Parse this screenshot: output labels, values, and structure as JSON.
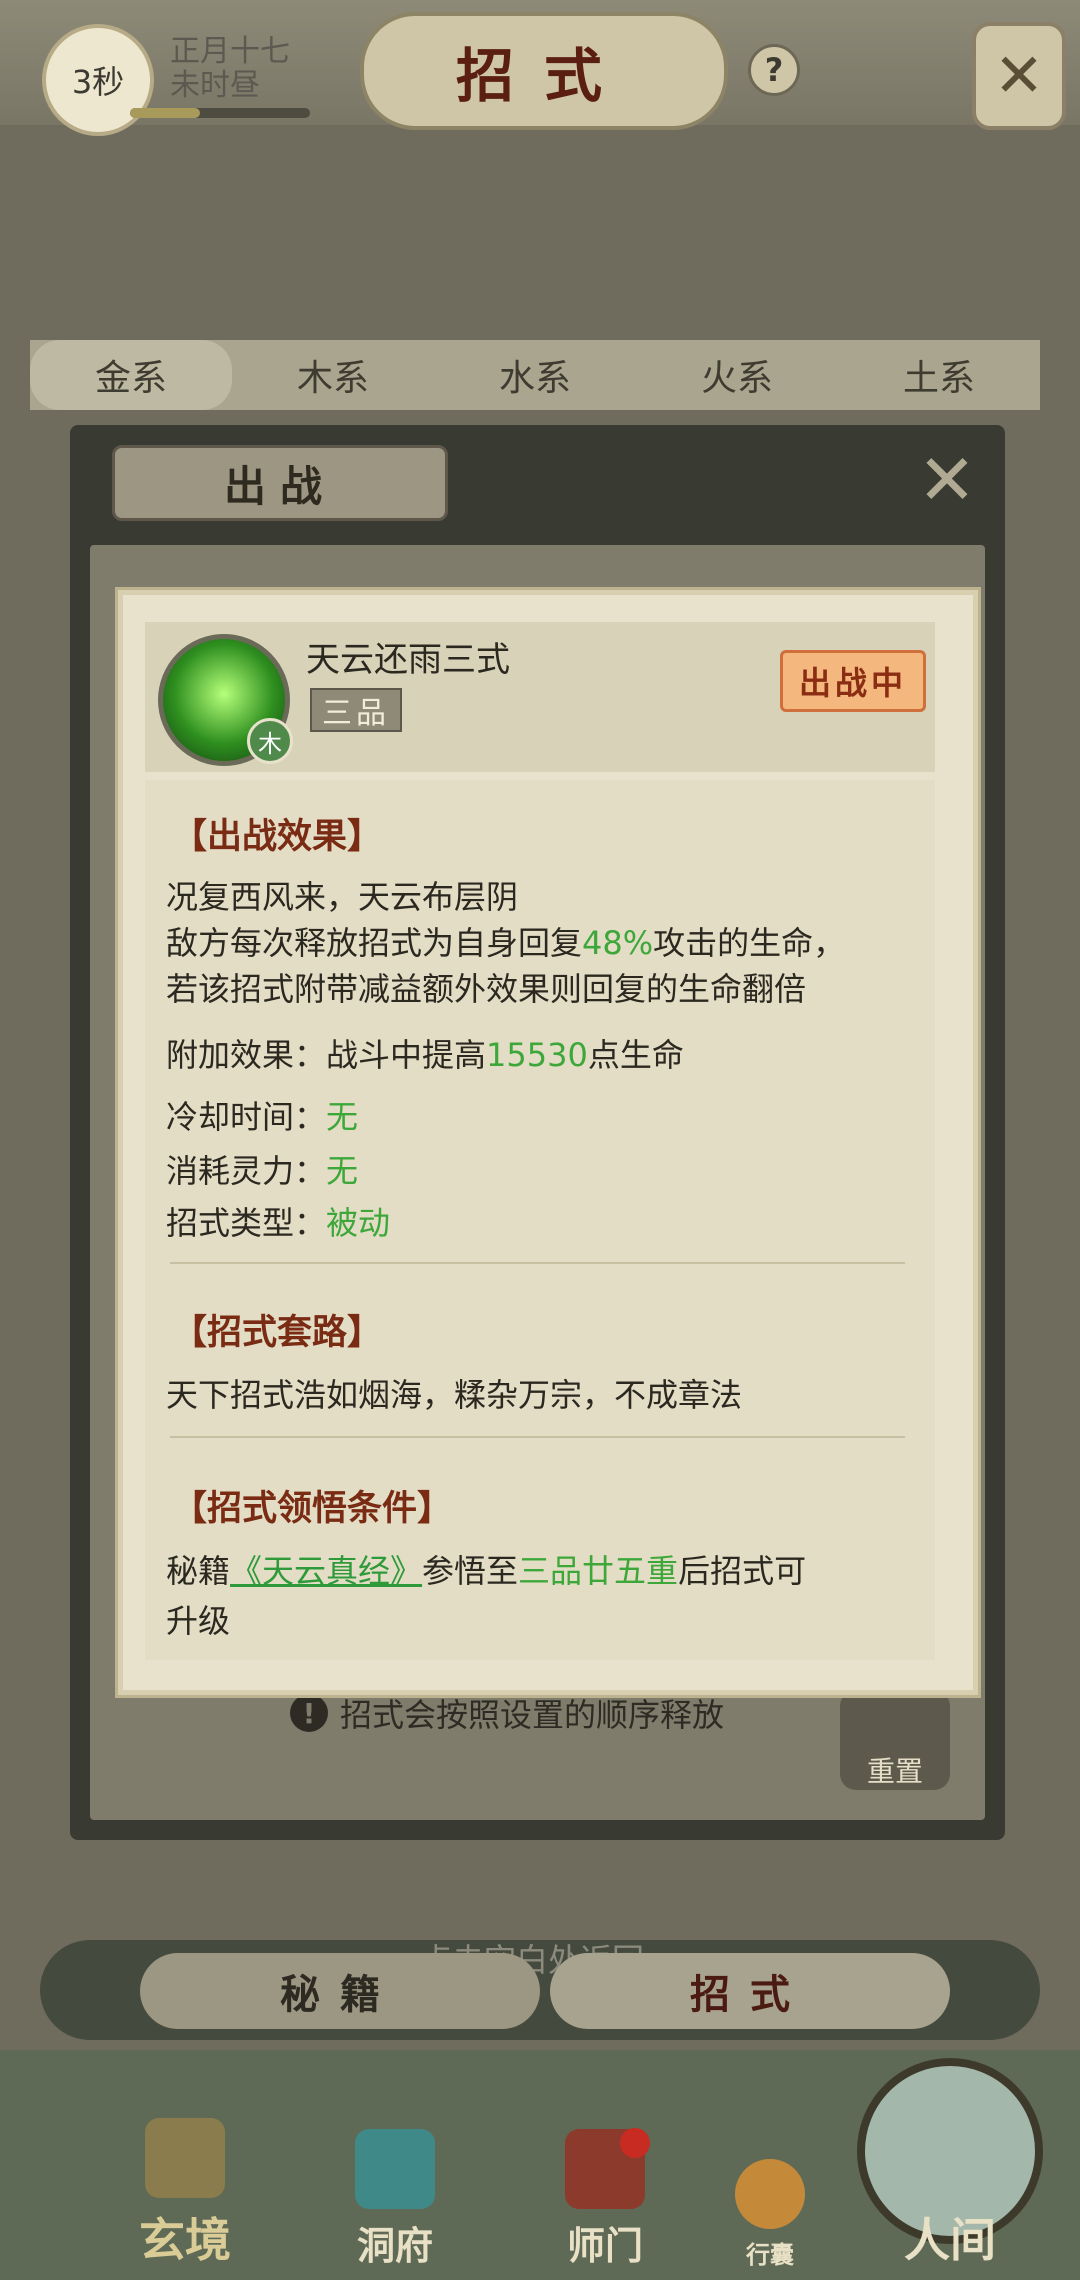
{
  "topbar": {
    "timer": "3秒",
    "date_line1": "正月十七",
    "date_line2": "未时昼",
    "title": "招式",
    "help": "?"
  },
  "element_tabs": [
    "金系",
    "木系",
    "水系",
    "火系",
    "土系"
  ],
  "panel": {
    "header": "出战",
    "hint": "招式会按照设置的顺序释放",
    "reset": "重置"
  },
  "skill": {
    "name": "天云还雨三式",
    "grade": "三品",
    "element_badge": "木",
    "status": "出战中",
    "effect_title": "【出战效果】",
    "effect_line1": "况复西风来，天云布层阴",
    "effect_line2_a": "敌方每次释放招式为自身回复",
    "effect_line2_value": "48%",
    "effect_line2_b": "攻击的生命，",
    "effect_line3": "若该招式附带减益额外效果则回复的生命翻倍",
    "extra_label": "附加效果：战斗中提高",
    "extra_value": "15530",
    "extra_suffix": "点生命",
    "cooldown_label": "冷却时间：",
    "cooldown_value": "无",
    "cost_label": "消耗灵力：",
    "cost_value": "无",
    "type_label": "招式类型：",
    "type_value": "被动",
    "routine_title": "【招式套路】",
    "routine_text": "天下招式浩如烟海，糅杂万宗，不成章法",
    "cond_title": "【招式领悟条件】",
    "cond_prefix": "秘籍",
    "cond_book": "《天云真经》",
    "cond_mid": "参悟至",
    "cond_level": "三品廿五重",
    "cond_suffix": "后招式可",
    "cond_line2": "升级"
  },
  "back_hint": "点击空白处返回",
  "bottom_tabs": {
    "left": "秘籍",
    "right": "招式"
  },
  "nav": {
    "item1": "玄境",
    "item2": "洞府",
    "item3": "师门",
    "item4": "行囊",
    "item5": "人间"
  },
  "colors": {
    "highlight_green": "#3ea73a",
    "section_brown": "#7a2b13",
    "status_orange": "#f4b77e"
  }
}
